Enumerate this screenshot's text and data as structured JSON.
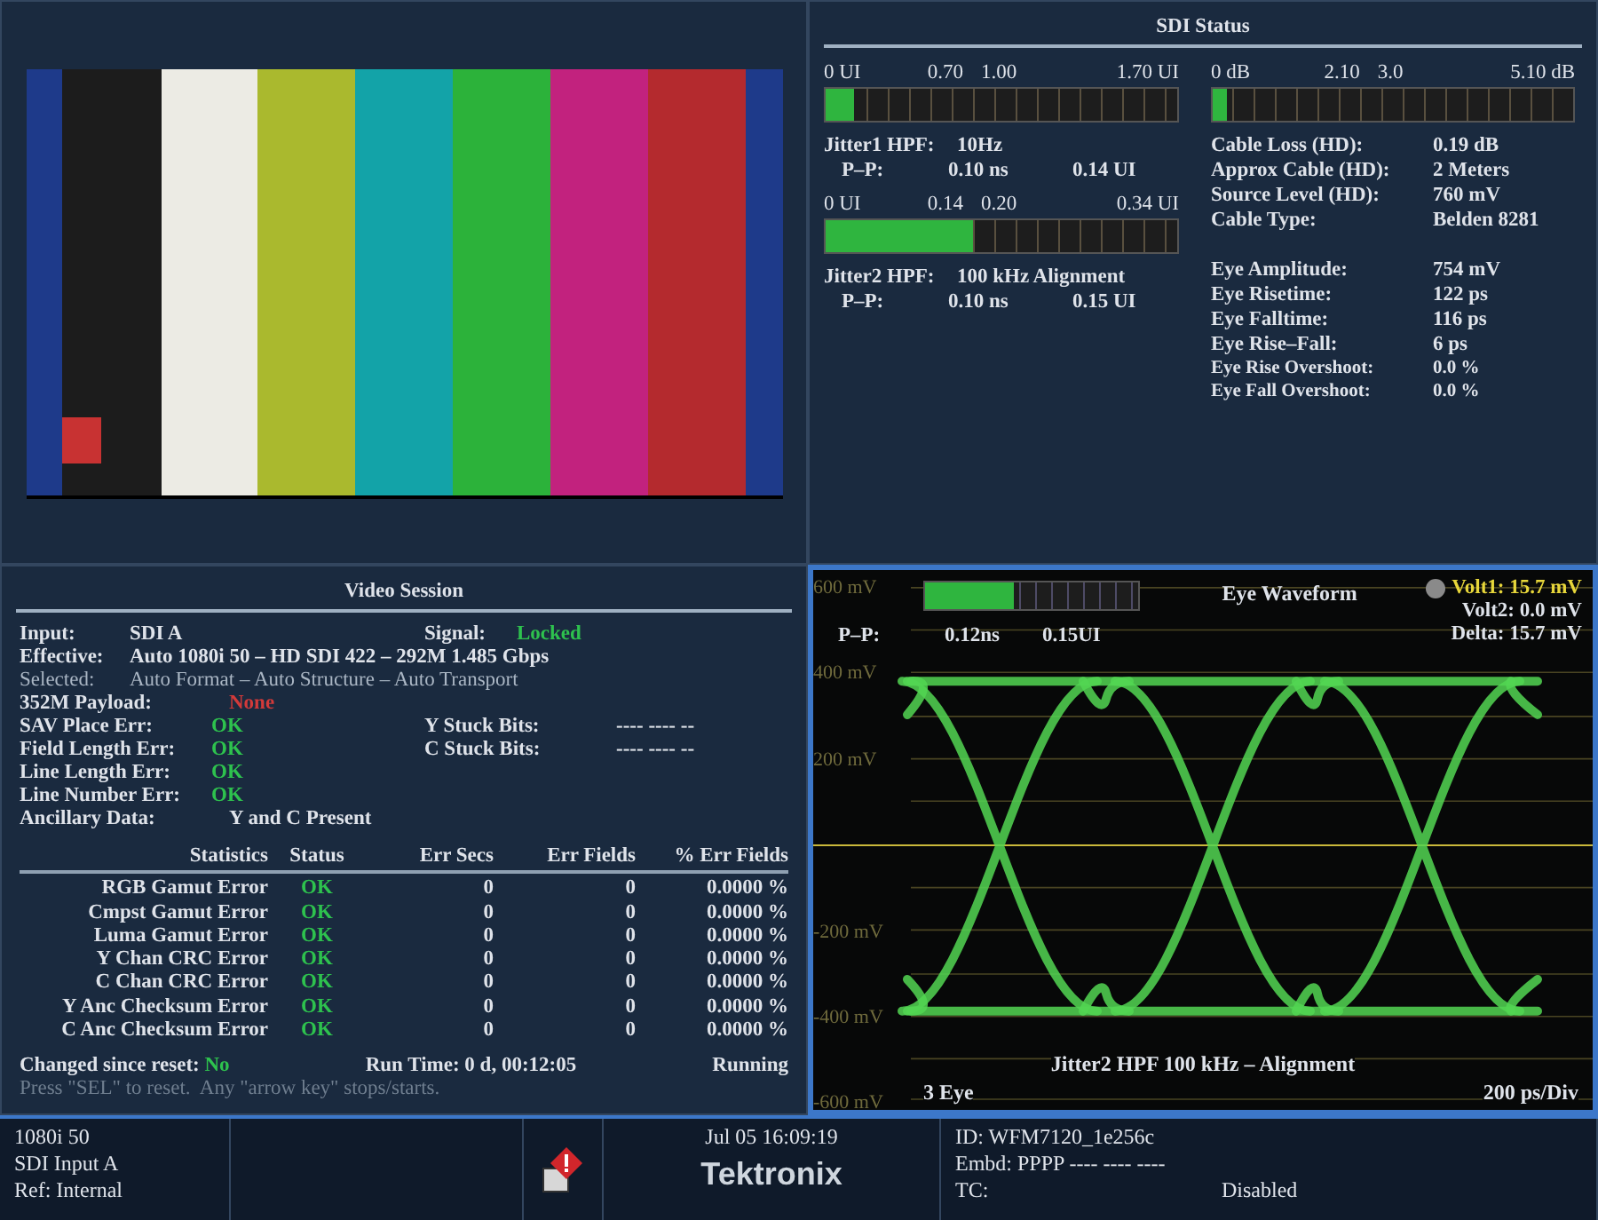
{
  "sdi_status": {
    "title": "SDI Status",
    "jitter_meters": [
      {
        "scale": [
          "0 UI",
          "0.70",
          "1.00",
          "1.70 UI"
        ],
        "level": 0.08,
        "filter_label": "Jitter1 HPF:",
        "filter_value": "10Hz",
        "pp_label": "P–P:",
        "pp_ns": "0.10 ns",
        "pp_ui": "0.14 UI"
      },
      {
        "scale": [
          "0 UI",
          "0.14",
          "0.20",
          "0.34 UI"
        ],
        "level": 0.42,
        "filter_label": "Jitter2 HPF:",
        "filter_value": "100 kHz Alignment",
        "pp_label": "P–P:",
        "pp_ns": "0.10 ns",
        "pp_ui": "0.15 UI"
      }
    ],
    "cable_meter": {
      "scale": [
        "0 dB",
        "2.10",
        "3.0",
        "5.10 dB"
      ],
      "level": 0.04
    },
    "cable_info": [
      {
        "label": "Cable Loss (HD):",
        "value": "0.19 dB"
      },
      {
        "label": "Approx Cable (HD):",
        "value": "2 Meters"
      },
      {
        "label": "Source Level (HD):",
        "value": "760 mV"
      },
      {
        "label": "Cable Type:",
        "value": "Belden 8281"
      }
    ],
    "eye_info": [
      {
        "label": "Eye Amplitude:",
        "value": "754 mV"
      },
      {
        "label": "Eye Risetime:",
        "value": "122 ps"
      },
      {
        "label": "Eye Falltime:",
        "value": "116 ps"
      },
      {
        "label": "Eye Rise–Fall:",
        "value": "6 ps"
      },
      {
        "label": "Eye Rise Overshoot:",
        "value": "0.0 %"
      },
      {
        "label": "Eye Fall Overshoot:",
        "value": "0.0 %"
      }
    ]
  },
  "video_session": {
    "title": "Video Session",
    "input": {
      "label": "Input:",
      "value": "SDI A"
    },
    "signal": {
      "label": "Signal:",
      "value": "Locked",
      "ok": true
    },
    "effective": {
      "label": "Effective:",
      "value": "Auto 1080i 50 – HD SDI 422 – 292M 1.485 Gbps"
    },
    "selected_mode": {
      "label": "Selected:",
      "value": "Auto Format – Auto Structure – Auto Transport"
    },
    "payload": {
      "label": "352M Payload:",
      "value": "None",
      "ok": false
    },
    "errors": [
      {
        "label": "SAV Place Err:",
        "value": "OK",
        "ok": true
      },
      {
        "label": "Field Length Err:",
        "value": "OK",
        "ok": true
      },
      {
        "label": "Line Length Err:",
        "value": "OK",
        "ok": true
      },
      {
        "label": "Line Number Err:",
        "value": "OK",
        "ok": true
      }
    ],
    "stuck_bits": [
      {
        "label": "Y Stuck Bits:",
        "value": "---- ---- --"
      },
      {
        "label": "C Stuck Bits:",
        "value": "---- ---- --"
      }
    ],
    "ancillary": {
      "label": "Ancillary Data:",
      "value": "Y and C Present"
    },
    "table": {
      "columns": [
        "Statistics",
        "Status",
        "Err Secs",
        "Err Fields",
        "% Err Fields"
      ],
      "rows": [
        {
          "name": "RGB Gamut Error",
          "status": "OK",
          "ok": true,
          "err_secs": "0",
          "err_fields": "0",
          "pct": "0.0000 %"
        },
        {
          "name": "Cmpst Gamut Error",
          "status": "OK",
          "ok": true,
          "err_secs": "0",
          "err_fields": "0",
          "pct": "0.0000 %"
        },
        {
          "name": "Luma Gamut Error",
          "status": "OK",
          "ok": true,
          "err_secs": "0",
          "err_fields": "0",
          "pct": "0.0000 %"
        },
        {
          "name": "Y Chan CRC Error",
          "status": "OK",
          "ok": true,
          "err_secs": "0",
          "err_fields": "0",
          "pct": "0.0000 %"
        },
        {
          "name": "C Chan CRC Error",
          "status": "OK",
          "ok": true,
          "err_secs": "0",
          "err_fields": "0",
          "pct": "0.0000 %"
        },
        {
          "name": "Y Anc Checksum Error",
          "status": "OK",
          "ok": true,
          "err_secs": "0",
          "err_fields": "0",
          "pct": "0.0000 %"
        },
        {
          "name": "C Anc Checksum Error",
          "status": "OK",
          "ok": true,
          "err_secs": "0",
          "err_fields": "0",
          "pct": "0.0000 %"
        }
      ]
    },
    "changed": {
      "label": "Changed since reset:",
      "value": "No",
      "ok": true
    },
    "run_time": "Run Time: 0 d, 00:12:05",
    "run_state": "Running",
    "hint": "Press \"SEL\" to reset.  Any \"arrow key\" stops/starts."
  },
  "eye_waveform": {
    "title": "Eye Waveform",
    "selected": true,
    "meter": {
      "level": 0.42
    },
    "pp_label": "P–P:",
    "pp_ns": "0.12ns",
    "pp_ui": "0.15UI",
    "cursors": [
      {
        "label": "Volt1: 15.7 mV",
        "active": true
      },
      {
        "label": "Volt2: 0.0 mV",
        "active": false
      },
      {
        "label": "Delta: 15.7 mV",
        "active": false
      }
    ],
    "y_labels": [
      "600 mV",
      "400 mV",
      "200 mV",
      "-200 mV",
      "-400 mV",
      "-600 mV"
    ],
    "caption": "Jitter2 HPF 100 kHz – Alignment",
    "mode": "3 Eye",
    "timebase": "200 ps/Div"
  },
  "status_bar": {
    "format_lines": [
      "1080i 50",
      "SDI Input A",
      "Ref: Internal"
    ],
    "datetime": "Jul 05 16:09:19",
    "brand": "Tektronix",
    "id": "ID: WFM7120_1e256c",
    "embedded": "Embd: PPPP ---- ---- ----",
    "tc_label": "TC:",
    "tc_value": "Disabled"
  }
}
